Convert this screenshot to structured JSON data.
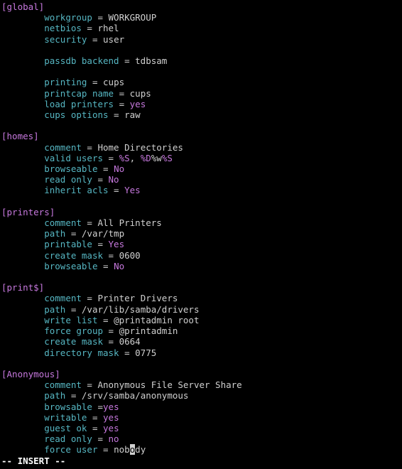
{
  "sections": {
    "global": {
      "header": "[global]",
      "workgroup_key": "workgroup",
      "workgroup_eq": " = ",
      "workgroup_val": "WORKGROUP",
      "netbios_key": "netbios",
      "netbios_eq": " = ",
      "netbios_val": "rhel",
      "security_key": "security",
      "security_eq": " = ",
      "security_val": "user",
      "passdb_key": "passdb backend",
      "passdb_eq": " = ",
      "passdb_val": "tdbsam",
      "printing_key": "printing",
      "printing_eq": " = ",
      "printing_val": "cups",
      "printcap_key": "printcap name",
      "printcap_eq": " = ",
      "printcap_val": "cups",
      "loadprinters_key": "load printers",
      "loadprinters_eq": " = ",
      "loadprinters_val": "yes",
      "cupsopts_key": "cups options",
      "cupsopts_eq": " = ",
      "cupsopts_val": "raw"
    },
    "homes": {
      "header": "[homes]",
      "comment_key": "comment",
      "comment_eq": " = ",
      "comment_val": "Home Directories",
      "validusers_key": "valid users",
      "validusers_eq": " = ",
      "validusers_v1": "%S",
      "validusers_sep": ", ",
      "validusers_v2": "%D",
      "validusers_v3": "%w",
      "validusers_v4": "%S",
      "browseable_key": "browseable",
      "browseable_eq": " = ",
      "browseable_val": "No",
      "readonly_key": "read only",
      "readonly_eq": " = ",
      "readonly_val": "No",
      "inheritacls_key": "inherit acls",
      "inheritacls_eq": " = ",
      "inheritacls_val": "Yes"
    },
    "printers": {
      "header": "[printers]",
      "comment_key": "comment",
      "comment_eq": " = ",
      "comment_val": "All Printers",
      "path_key": "path",
      "path_eq": " = ",
      "path_val": "/var/tmp",
      "printable_key": "printable",
      "printable_eq": " = ",
      "printable_val": "Yes",
      "createmask_key": "create mask",
      "createmask_eq": " = ",
      "createmask_val": "0600",
      "browseable_key": "browseable",
      "browseable_eq": " = ",
      "browseable_val": "No"
    },
    "printdollar": {
      "header": "[print$]",
      "comment_key": "comment",
      "comment_eq": " = ",
      "comment_val": "Printer Drivers",
      "path_key": "path",
      "path_eq": " = ",
      "path_val": "/var/lib/samba/drivers",
      "writelist_key": "write list",
      "writelist_eq": " = ",
      "writelist_val": "@printadmin root",
      "forcegroup_key": "force group",
      "forcegroup_eq": " = ",
      "forcegroup_val": "@printadmin",
      "createmask_key": "create mask",
      "createmask_eq": " = ",
      "createmask_val": "0664",
      "dirmask_key": "directory mask",
      "dirmask_eq": " = ",
      "dirmask_val": "0775"
    },
    "anonymous": {
      "header": "[Anonymous]",
      "comment_key": "comment",
      "comment_eq": " = ",
      "comment_val": "Anonymous File Server Share",
      "path_key": "path",
      "path_eq": " = ",
      "path_val": "/srv/samba/anonymous",
      "browsable_key": "browsable",
      "browsable_eq": " =",
      "browsable_val": "yes",
      "writable_key": "writable",
      "writable_eq": " = ",
      "writable_val": "yes",
      "guestok_key": "guest ok",
      "guestok_eq": " = ",
      "guestok_val": "yes",
      "readonly_key": "read only",
      "readonly_eq": " = ",
      "readonly_val": "no",
      "forceuser_key": "force user",
      "forceuser_eq": " = ",
      "forceuser_val_pre": "nob",
      "forceuser_val_cur": "o",
      "forceuser_val_post": "dy"
    }
  },
  "indent": "        ",
  "status_line": "-- INSERT --"
}
